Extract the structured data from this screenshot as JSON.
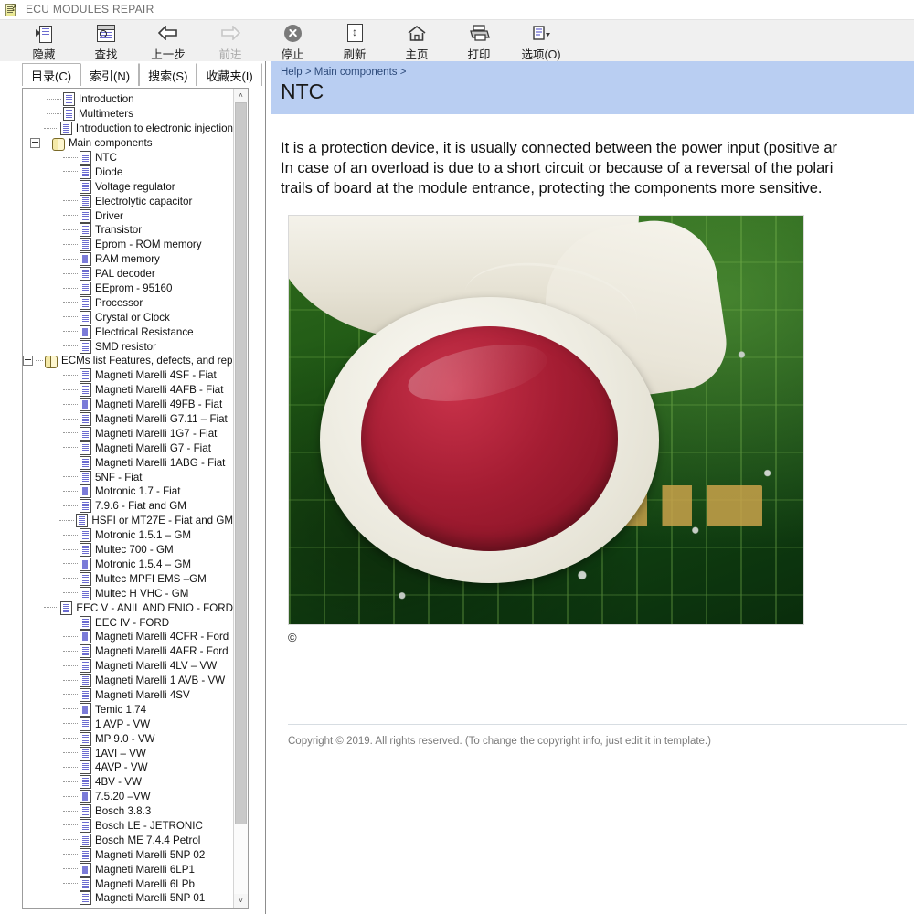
{
  "window": {
    "title": "ECU MODULES REPAIR",
    "title_icon": "help-book-question-icon"
  },
  "toolbar": {
    "buttons": [
      {
        "label": "隐藏",
        "icon": "hide-pane-icon",
        "disabled": false
      },
      {
        "label": "查找",
        "icon": "find-search-icon",
        "disabled": false
      },
      {
        "label": "上一步",
        "icon": "back-arrow-icon",
        "disabled": false
      },
      {
        "label": "前进",
        "icon": "forward-arrow-icon",
        "disabled": true
      },
      {
        "label": "停止",
        "icon": "stop-circle-icon",
        "disabled": false
      },
      {
        "label": "刷新",
        "icon": "refresh-page-icon",
        "disabled": false
      },
      {
        "label": "主页",
        "icon": "home-icon",
        "disabled": false
      },
      {
        "label": "打印",
        "icon": "printer-icon",
        "disabled": false
      },
      {
        "label": "选项(O)",
        "icon": "options-dropdown-icon",
        "disabled": false
      }
    ]
  },
  "left_pane": {
    "tabs": [
      {
        "label": "目录(C)",
        "active": true
      },
      {
        "label": "索引(N)",
        "active": false
      },
      {
        "label": "搜索(S)",
        "active": false
      },
      {
        "label": "收藏夹(I)",
        "active": false
      }
    ],
    "scrollbar": {
      "up_arrow": "˄",
      "down_arrow": "˅"
    },
    "tree": [
      {
        "label": "Introduction",
        "depth": 1,
        "icon": "page",
        "expander": "none"
      },
      {
        "label": "Multimeters",
        "depth": 1,
        "icon": "page",
        "expander": "none"
      },
      {
        "label": "Introduction to electronic injection",
        "depth": 1,
        "icon": "page",
        "expander": "none"
      },
      {
        "label": "Main components",
        "depth": 0,
        "icon": "book-open",
        "expander": "minus"
      },
      {
        "label": "NTC",
        "depth": 2,
        "icon": "page",
        "expander": "none"
      },
      {
        "label": "Diode",
        "depth": 2,
        "icon": "page",
        "expander": "none"
      },
      {
        "label": "Voltage regulator",
        "depth": 2,
        "icon": "page",
        "expander": "none"
      },
      {
        "label": "Electrolytic capacitor",
        "depth": 2,
        "icon": "page",
        "expander": "none"
      },
      {
        "label": "Driver",
        "depth": 2,
        "icon": "page",
        "expander": "none"
      },
      {
        "label": "Transistor",
        "depth": 2,
        "icon": "page",
        "expander": "none"
      },
      {
        "label": "Eprom - ROM memory",
        "depth": 2,
        "icon": "page",
        "expander": "none"
      },
      {
        "label": "RAM memory",
        "depth": 2,
        "icon": "page-solid",
        "expander": "none"
      },
      {
        "label": "PAL decoder",
        "depth": 2,
        "icon": "page",
        "expander": "none"
      },
      {
        "label": "EEprom - 95160",
        "depth": 2,
        "icon": "page",
        "expander": "none"
      },
      {
        "label": "Processor",
        "depth": 2,
        "icon": "page",
        "expander": "none"
      },
      {
        "label": "Crystal or Clock",
        "depth": 2,
        "icon": "page",
        "expander": "none"
      },
      {
        "label": "Electrical Resistance",
        "depth": 2,
        "icon": "page-solid",
        "expander": "none"
      },
      {
        "label": "SMD resistor",
        "depth": 2,
        "icon": "page",
        "expander": "none"
      },
      {
        "label": "ECMs list Features, defects, and repair",
        "depth": 0,
        "icon": "book-open",
        "expander": "minus"
      },
      {
        "label": "Magneti Marelli 4SF - Fiat",
        "depth": 2,
        "icon": "page",
        "expander": "none"
      },
      {
        "label": "Magneti Marelli 4AFB - Fiat",
        "depth": 2,
        "icon": "page",
        "expander": "none"
      },
      {
        "label": "Magneti Marelli 49FB - Fiat",
        "depth": 2,
        "icon": "page-solid",
        "expander": "none"
      },
      {
        "label": "Magneti Marelli G7.11 – Fiat",
        "depth": 2,
        "icon": "page",
        "expander": "none"
      },
      {
        "label": "Magneti Marelli 1G7 - Fiat",
        "depth": 2,
        "icon": "page",
        "expander": "none"
      },
      {
        "label": "Magneti Marelli G7 - Fiat",
        "depth": 2,
        "icon": "page",
        "expander": "none"
      },
      {
        "label": "Magneti Marelli 1ABG - Fiat",
        "depth": 2,
        "icon": "page",
        "expander": "none"
      },
      {
        "label": "5NF - Fiat",
        "depth": 2,
        "icon": "page",
        "expander": "none"
      },
      {
        "label": "Motronic 1.7 - Fiat",
        "depth": 2,
        "icon": "page-solid",
        "expander": "none"
      },
      {
        "label": "7.9.6 - Fiat and GM",
        "depth": 2,
        "icon": "page",
        "expander": "none"
      },
      {
        "label": "HSFI or MT27E - Fiat and GM",
        "depth": 2,
        "icon": "page",
        "expander": "none"
      },
      {
        "label": "Motronic 1.5.1 – GM",
        "depth": 2,
        "icon": "page",
        "expander": "none"
      },
      {
        "label": "Multec 700 - GM",
        "depth": 2,
        "icon": "page",
        "expander": "none"
      },
      {
        "label": "Motronic 1.5.4 – GM",
        "depth": 2,
        "icon": "page-solid",
        "expander": "none"
      },
      {
        "label": "Multec MPFI EMS –GM",
        "depth": 2,
        "icon": "page",
        "expander": "none"
      },
      {
        "label": "Multec H VHC - GM",
        "depth": 2,
        "icon": "page",
        "expander": "none"
      },
      {
        "label": "EEC V - ANIL AND ENIO - FORD",
        "depth": 2,
        "icon": "page",
        "expander": "none"
      },
      {
        "label": "EEC IV - FORD",
        "depth": 2,
        "icon": "page",
        "expander": "none"
      },
      {
        "label": "Magneti Marelli 4CFR - Ford",
        "depth": 2,
        "icon": "page-solid",
        "expander": "none"
      },
      {
        "label": "Magneti Marelli 4AFR - Ford",
        "depth": 2,
        "icon": "page",
        "expander": "none"
      },
      {
        "label": "Magneti Marelli 4LV – VW",
        "depth": 2,
        "icon": "page",
        "expander": "none"
      },
      {
        "label": "Magneti Marelli 1 AVB - VW",
        "depth": 2,
        "icon": "page",
        "expander": "none"
      },
      {
        "label": "Magneti Marelli 4SV",
        "depth": 2,
        "icon": "page",
        "expander": "none"
      },
      {
        "label": "Temic 1.74",
        "depth": 2,
        "icon": "page-solid",
        "expander": "none"
      },
      {
        "label": "1 AVP - VW",
        "depth": 2,
        "icon": "page",
        "expander": "none"
      },
      {
        "label": "MP 9.0 - VW",
        "depth": 2,
        "icon": "page",
        "expander": "none"
      },
      {
        "label": "1AVI – VW",
        "depth": 2,
        "icon": "page",
        "expander": "none"
      },
      {
        "label": "4AVP - VW",
        "depth": 2,
        "icon": "page",
        "expander": "none"
      },
      {
        "label": "4BV - VW",
        "depth": 2,
        "icon": "page",
        "expander": "none"
      },
      {
        "label": "7.5.20 –VW",
        "depth": 2,
        "icon": "page-solid",
        "expander": "none"
      },
      {
        "label": "Bosch 3.8.3",
        "depth": 2,
        "icon": "page",
        "expander": "none"
      },
      {
        "label": "Bosch LE - JETRONIC",
        "depth": 2,
        "icon": "page",
        "expander": "none"
      },
      {
        "label": "Bosch ME 7.4.4 Petrol",
        "depth": 2,
        "icon": "page",
        "expander": "none"
      },
      {
        "label": "Magneti Marelli 5NP 02",
        "depth": 2,
        "icon": "page",
        "expander": "none"
      },
      {
        "label": "Magneti Marelli 6LP1",
        "depth": 2,
        "icon": "page-solid",
        "expander": "none"
      },
      {
        "label": "Magneti Marelli 6LPb",
        "depth": 2,
        "icon": "page",
        "expander": "none"
      },
      {
        "label": "Magneti Marelli 5NP 01",
        "depth": 2,
        "icon": "page",
        "expander": "none"
      }
    ]
  },
  "right_pane": {
    "breadcrumb": "Help > Main components >",
    "title": "NTC",
    "body": "It is a protection device, it is usually connected between the power input (positive ar\nIn case of an overload is due to a short circuit or because of a reversal of the polari\ntrails of board at the module entrance, protecting the components more sensitive.",
    "image_caption": "©",
    "image_alt": "ntc-thermistor-on-pcb-photo",
    "footer": "Copyright © 2019. All rights reserved. (To change the copyright info, just edit it in template.)"
  },
  "colors": {
    "breadcrumb_band": "#b9cef2",
    "toolbar_bg": "#f0f0f0",
    "ntc_red": "#a51d33",
    "pcb_green": "#1d5614"
  }
}
